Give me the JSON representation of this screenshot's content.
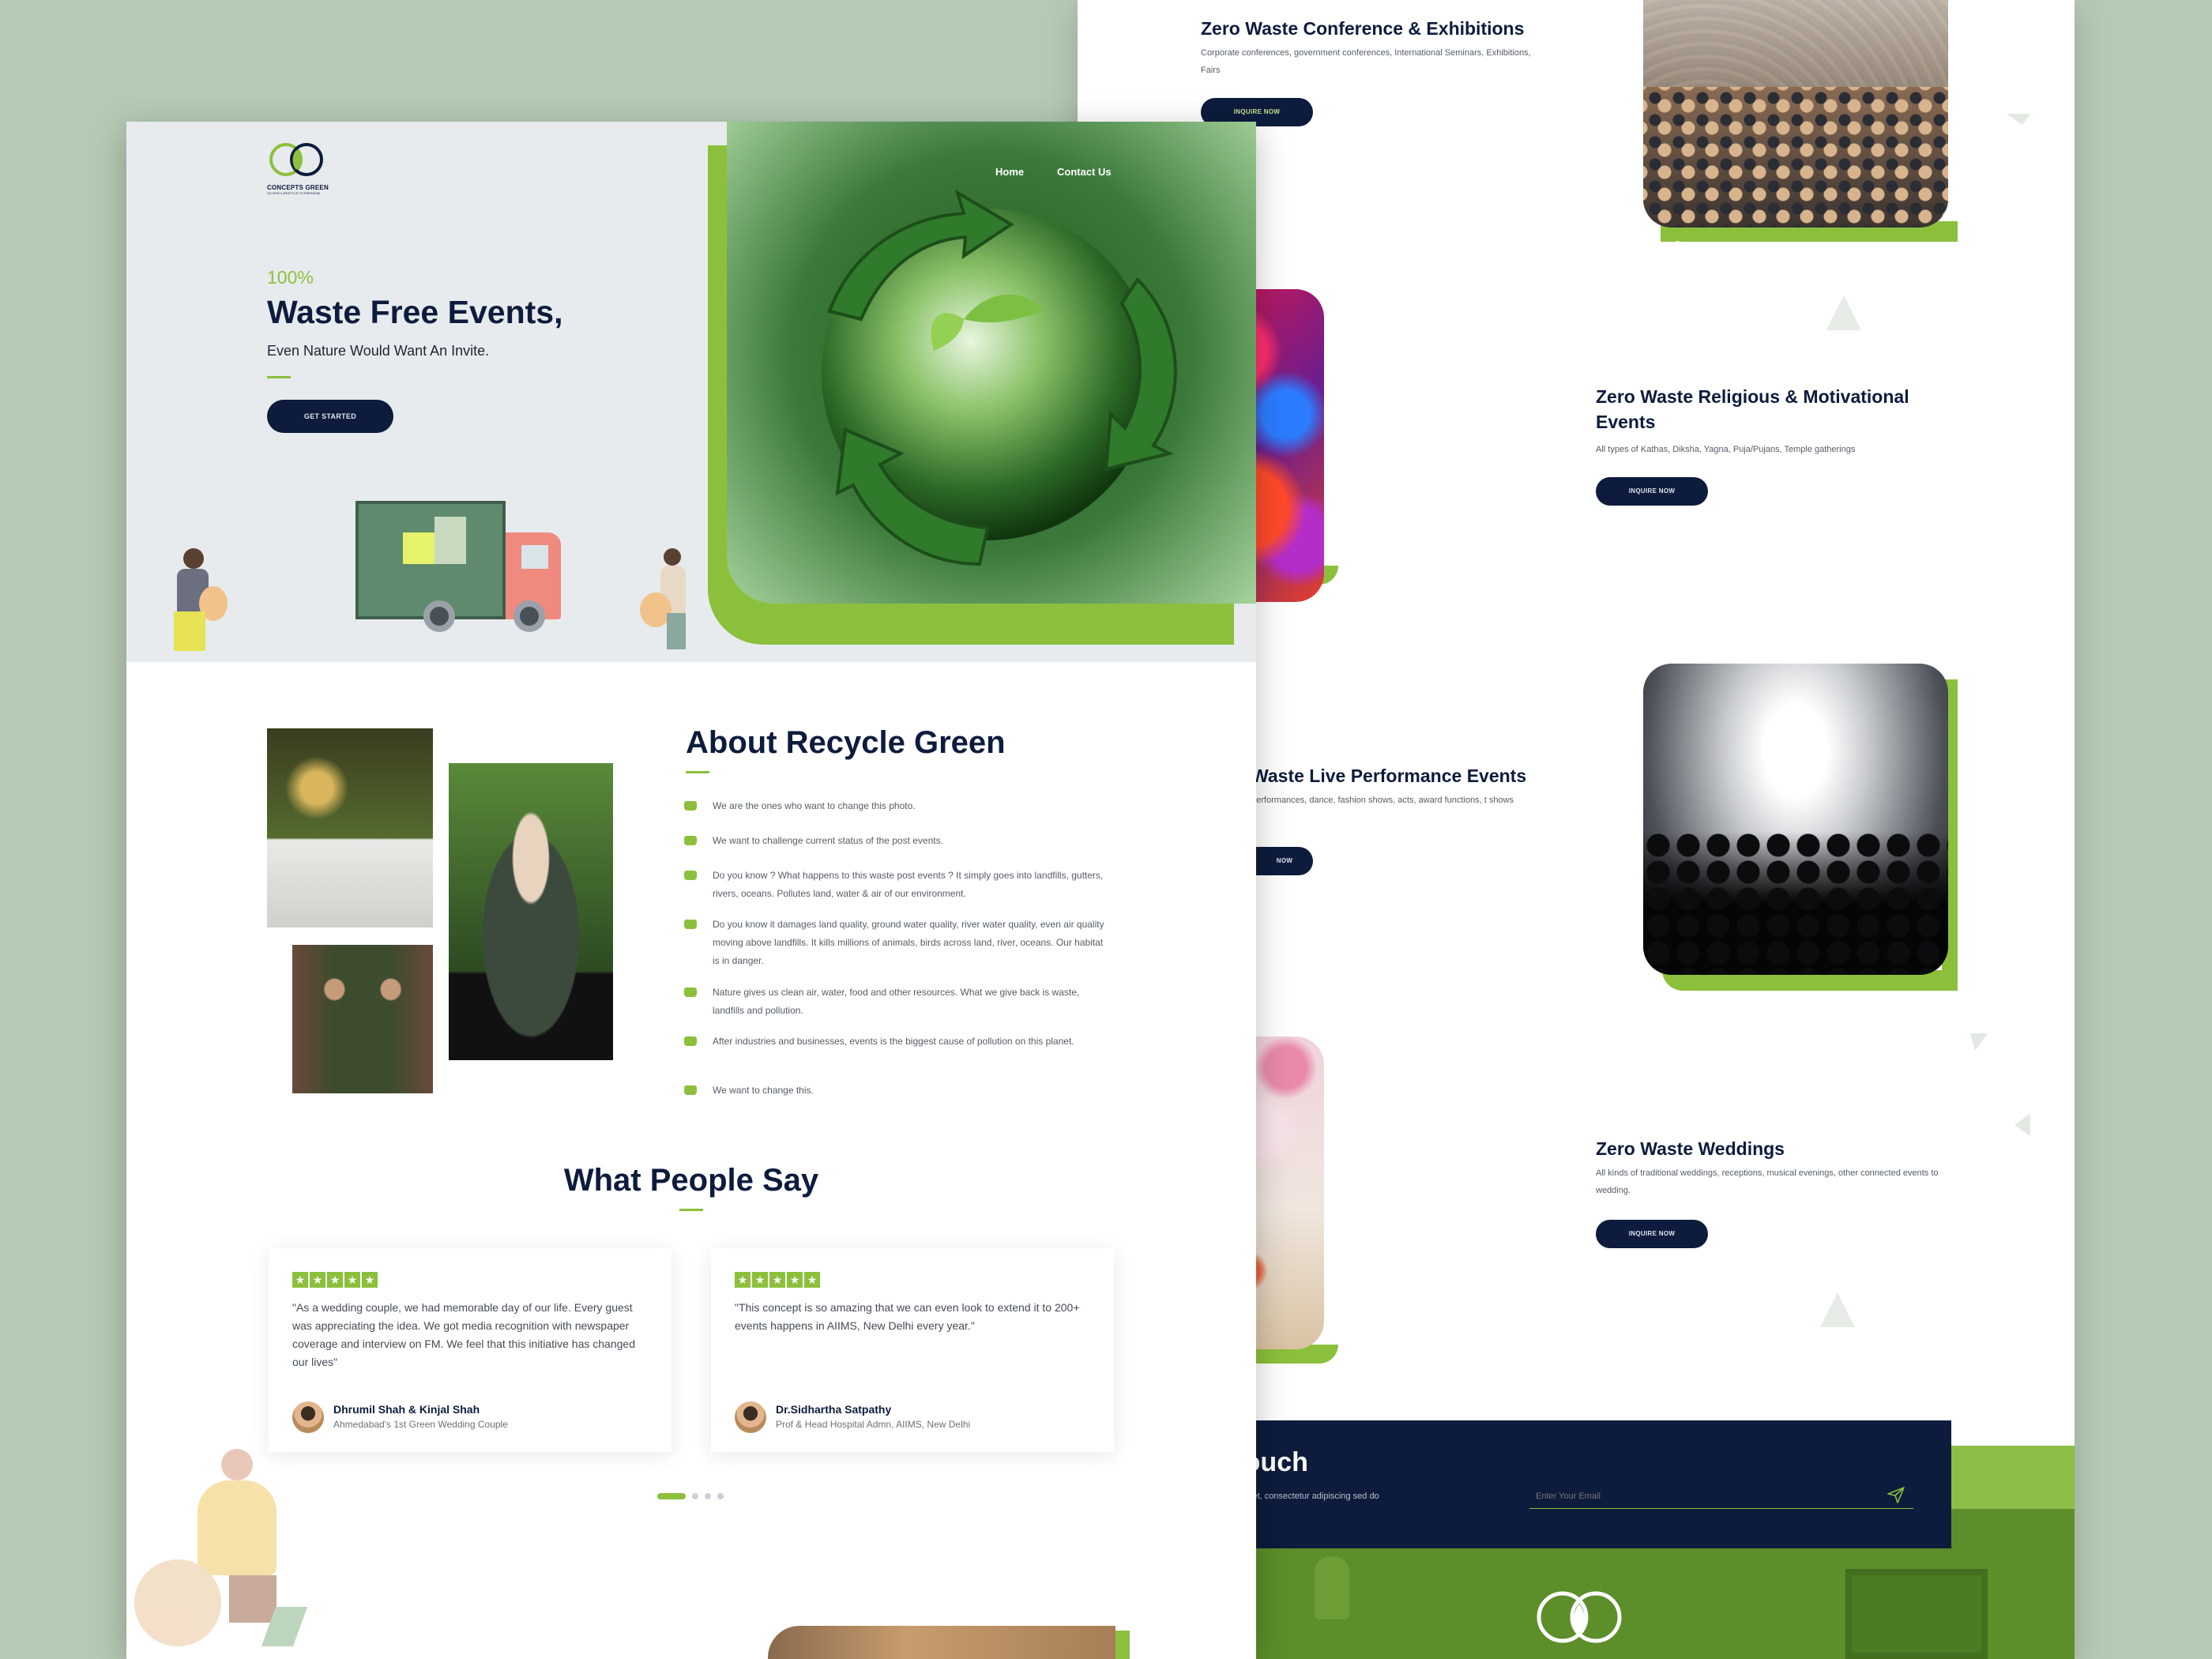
{
  "brand": {
    "name": "CONCEPTS GREEN",
    "tagline": "SO WITH LIFESTYLE TO FREEDOM"
  },
  "nav": {
    "home": "Home",
    "contact": "Contact Us"
  },
  "hero": {
    "eyebrow": "100%",
    "title": "Waste Free Events,",
    "subtitle": "Even Nature Would Want An Invite.",
    "cta": "GET STARTED"
  },
  "about": {
    "title": "About Recycle Green",
    "items": [
      "We are the ones who want to change this photo.",
      "We want to challenge current status of the post events.",
      "Do you know ? What happens to this waste post events ? It simply goes into landfills, gutters, rivers, oceans. Pollutes land, water & air of our environment.",
      "Do you know it damages land quality, ground water quality, river water quality, even air quality moving above landfills. It kills millions of animals, birds across land, river, oceans. Our habitat is in danger.",
      "Nature gives us clean air, water, food and other resources. What we give back is waste, landfills and pollution.",
      "After industries and businesses, events is the biggest cause of pollution on this planet.",
      "We want to change this."
    ]
  },
  "testimonials": {
    "title": "What People Say",
    "items": [
      {
        "quote": "\"As a wedding couple, we had memorable day of our life. Every guest was appreciating the idea. We got media recognition with newspaper coverage and interview on FM. We feel that this initiative has changed our lives\"",
        "name": "Dhrumil Shah & Kinjal Shah",
        "role": "Ahmedabad's 1st Green Wedding Couple",
        "rating": 5
      },
      {
        "quote": "\"This concept is so amazing that we can even look to extend it to 200+ events happens in AIIMS, New Delhi every year.\"",
        "name": "Dr.Sidhartha Satpathy",
        "role": "Prof & Head Hospital Admn, AIIMS, New Delhi",
        "rating": 5
      }
    ]
  },
  "events": [
    {
      "title": "Zero Waste  Conference & Exhibitions",
      "desc": "Corporate conferences, government conferences, International Seminars, Exhibitions, Fairs",
      "cta": "INQUIRE NOW"
    },
    {
      "title": "Zero Waste Religious & Motivational Events",
      "desc": "All types of Kathas, Diksha, Yagna, Puja/Pujans, Temple gatherings",
      "cta": "INQUIRE NOW"
    },
    {
      "title": "Waste Live Performance Events",
      "desc": "performances, dance, fashion shows, acts, award functions, t shows",
      "cta": "NOW"
    },
    {
      "title": "Zero Waste Weddings",
      "desc": "All kinds of traditional weddings, receptions, musical evenings, other connected events to wedding.",
      "cta": "INQUIRE NOW"
    }
  ],
  "contact": {
    "title": "et in touch",
    "text": "m ipsum dolor sit amet, consectetur adipiscing sed do eiusmod tempor",
    "email_placeholder": "Enter Your Email"
  },
  "colors": {
    "accent": "#8cc03c",
    "navy": "#0d1c3d",
    "page_bg": "#b5cab5",
    "hero_bg": "#e8ebee"
  }
}
